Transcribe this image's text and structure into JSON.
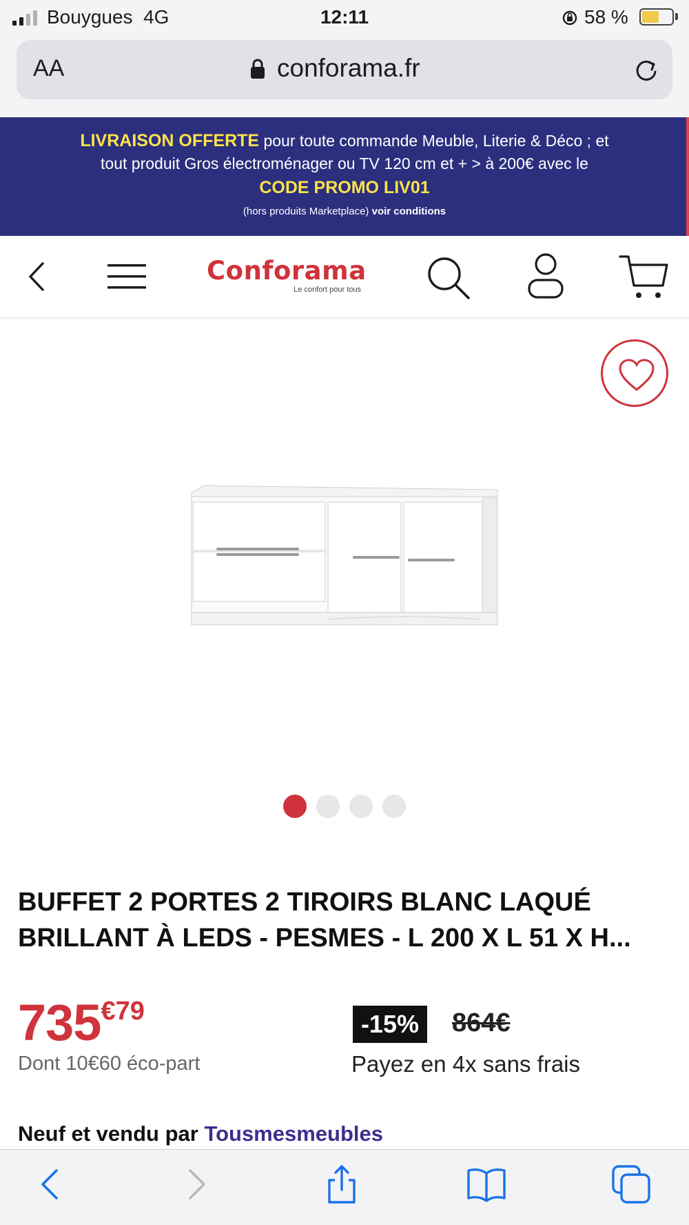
{
  "status_bar": {
    "carrier": "Bouygues",
    "network": "4G",
    "time": "12:11",
    "battery_percent": "58 %",
    "battery_level": 0.58
  },
  "browser": {
    "text_size_label": "AA",
    "url": "conforama.fr",
    "icons": [
      "lock-icon",
      "reload-icon"
    ]
  },
  "promo": {
    "line1_highlight": "LIVRAISON OFFERTE",
    "line1_rest": " pour toute commande Meuble, Literie & Déco ; et",
    "line2": "tout produit Gros électroménager ou TV 120 cm et + > à 200€ avec le",
    "line3_code": "CODE PROMO LIV01",
    "line4_note": "(hors produits Marketplace) ",
    "line4_link": "voir conditions"
  },
  "header": {
    "logo_text": "Conforama",
    "logo_tagline": "Le confort pour tous",
    "icons": [
      "back-chevron-icon",
      "menu-icon",
      "search-icon",
      "account-icon",
      "cart-icon"
    ]
  },
  "gallery": {
    "image_count": 4,
    "active_index": 0
  },
  "product": {
    "title": "BUFFET 2 PORTES 2 TIROIRS BLANC LAQUÉ BRILLANT À LEDS - PESMES - L 200 X L 51 X H...",
    "price_int": "735",
    "price_dec": "€79",
    "eco_part": "Dont 10€60 éco-part",
    "discount": "-15%",
    "old_price": "864€",
    "installments": "Payez en 4x sans frais",
    "seller_prefix": "Neuf et vendu par ",
    "seller_name": "Tousmesmeubles"
  },
  "colors": {
    "brand_red": "#d0333b",
    "promo_bg": "#2b2f7e",
    "promo_highlight": "#ffe24a",
    "seller_color": "#3b2f8e",
    "ios_blue": "#1a73e8"
  },
  "toolbar": {
    "icons": [
      "back-icon",
      "forward-icon",
      "share-icon",
      "bookmarks-icon",
      "tabs-icon"
    ]
  }
}
